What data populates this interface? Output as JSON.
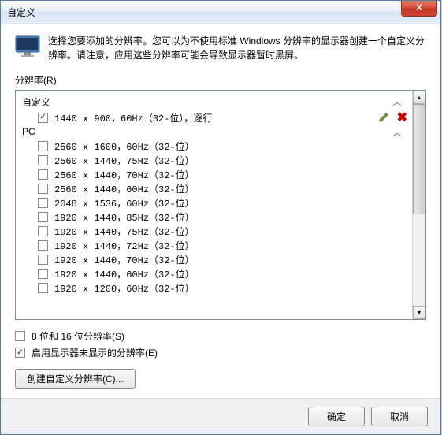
{
  "title": "自定义",
  "description": "选择您要添加的分辨率。您可以为不使用标准 Windiows 分辨率的显示器创建一个自定义分辨率。请注意，应用这些分辨率可能会导致显示器暂时黑屏。",
  "resolution_label": "分辨率(R)",
  "groups": {
    "custom": "自定义",
    "pc": "PC"
  },
  "custom_item": "1440 x 900，60Hz（32-位），逐行",
  "pc_items": [
    "2560 x 1600，60Hz（32-位）",
    "2560 x 1440，75Hz（32-位）",
    "2560 x 1440，70Hz（32-位）",
    "2560 x 1440，60Hz（32-位）",
    "2048 x 1536，60Hz（32-位）",
    "1920 x 1440，85Hz（32-位）",
    "1920 x 1440，75Hz（32-位）",
    "1920 x 1440，72Hz（32-位）",
    "1920 x 1440，70Hz（32-位）",
    "1920 x 1440，60Hz（32-位）",
    "1920 x 1200，60Hz（32-位）"
  ],
  "checkbox1": "8 位和 16 位分辨率(S)",
  "checkbox2": "启用显示器未显示的分辨率(E)",
  "create_btn": "创建自定义分辨率(C)...",
  "ok_btn": "确定",
  "cancel_btn": "取消"
}
